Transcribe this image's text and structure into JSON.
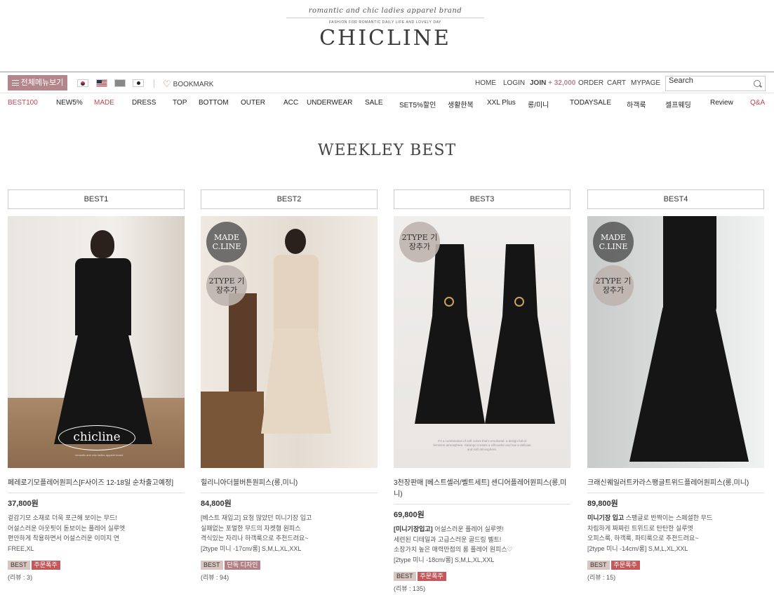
{
  "header": {
    "tagline": "romantic and chic ladies apparel brand",
    "subline": "FASHION FOR ROMANTIC DAILY LIFE AND LOVELY DAY",
    "logo": "CHICLINE"
  },
  "topbar": {
    "menu_label": "전체메뉴보기",
    "bookmark_label": "BOOKMARK",
    "links": {
      "home": "HOME",
      "login": "LOGIN",
      "join": "JOIN",
      "join_bonus": "+ 32,000",
      "order": "ORDER",
      "cart": "CART",
      "mypage": "MYPAGE"
    },
    "search_placeholder": "Search"
  },
  "categories": [
    "BEST100",
    "NEW5%",
    "MADE",
    "DRESS",
    "TOP",
    "BOTTOM",
    "OUTER",
    "ACC",
    "UNDERWEAR",
    "SALE",
    "SET5%할인",
    "생활한복",
    "XXL Plus",
    "롱/미니",
    "TODAYSALE",
    "하객룩",
    "셀프웨딩",
    "Review",
    "Q&A"
  ],
  "section_title": "WEEKLEY BEST",
  "products": [
    {
      "rank": "BEST1",
      "watermark": "chicline",
      "watermark_sub": "romantic and chic ladies apparel brand",
      "name": "페레로기모플레어원피스[F사이즈 12-18일 순차출고예정]",
      "price": "37,800원",
      "desc": [
        "겉감기모 소재로 더욱 포근해 보이는 무드!",
        "어설스러운 아웃핏이 돋보이는 플레어 실루엣",
        "편안하게 착용하면서 어설스러운 이미지 연",
        "FREE,XL"
      ],
      "badges": [
        "BEST",
        "주문폭주"
      ],
      "reviews": "(리뷰 : 3)"
    },
    {
      "rank": "BEST2",
      "circle1": "MADE C.LINE",
      "circle2": "2TYPE 기장추가",
      "name": "힐리니아더블버튼원피스(롱,미니)",
      "price": "84,800원",
      "desc": [
        "[베스트 재입고] 요청 많았던 미니기장 입고",
        "실패없는 포멀한 무드의 자켓형 원피스",
        "격식있는 자리나 하객룩으로 추천드려요~",
        "[2type 미니 -17cm/롱] S,M,L,XL,XXL"
      ],
      "badges": [
        "BEST",
        "단독 디자인"
      ],
      "reviews": "(리뷰 : 94)"
    },
    {
      "rank": "BEST3",
      "circle2": "2TYPE 기장추가",
      "caption": "It's a combination of soft colors that's emotional. a design full of feminine atmosphere. Satango creates a silhouette and has a delicate and soft atmosphere.",
      "name": "3천장판매 [베스트셀러/벨트세트] 센디어플레어원피스(롱,미니)",
      "price": "69,800원",
      "desc_hl": "[미니기장입고]",
      "desc": [
        "어설스러운 플레어 실루엣!",
        "세련된 디테일과 고급스러운 골드링 벨트!",
        "소장가치 높은 매력만점의 롱 플레어 원피스♡",
        "[2type 미니 -18cm/롱] S,M,L,XL,XXL"
      ],
      "badges": [
        "BEST",
        "주문폭주"
      ],
      "reviews": "(리뷰 : 135)"
    },
    {
      "rank": "BEST4",
      "circle1": "MADE C.LINE",
      "circle2": "2TYPE 기장추가",
      "name": "크래신퀘일러트카라스팽글트위드플레어원피스(롱,미니)",
      "price": "89,800원",
      "desc_hl": "미니기장 입고",
      "desc": [
        "스팽글로 반짝이는 스페셜한 무드",
        "차림하게 짜짜린 트위드로 탄탄한 실루엣",
        "오피스룩, 하객룩, 파티룩으로 추천드려요~",
        "[2type 미니 -14cm/롱] S,M,L,XL,XXL"
      ],
      "badges": [
        "BEST",
        "주문폭주"
      ],
      "reviews": "(리뷰 : 15)"
    }
  ]
}
